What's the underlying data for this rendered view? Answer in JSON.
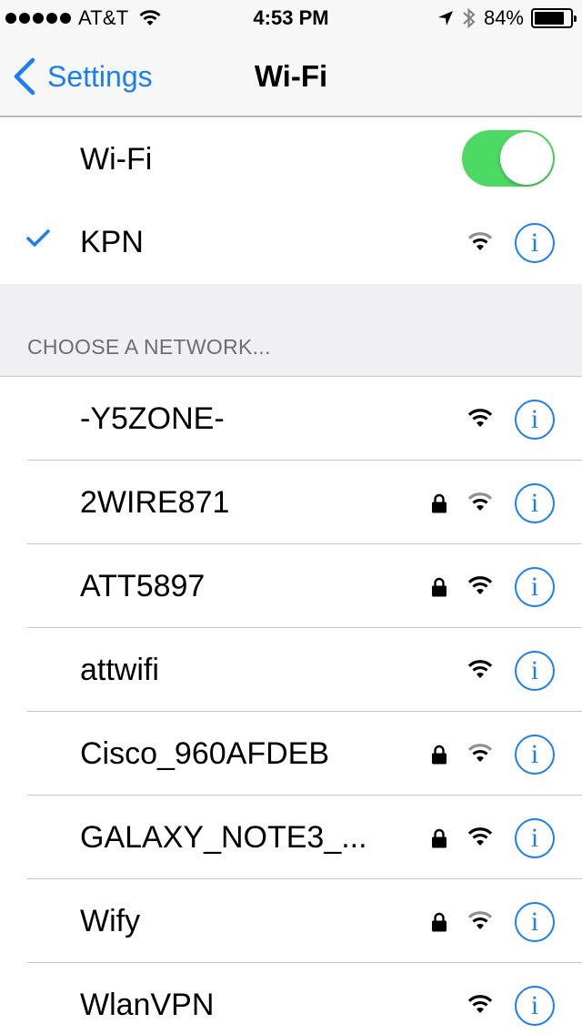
{
  "status_bar": {
    "carrier": "AT&T",
    "time": "4:53 PM",
    "battery_percent_label": "84%",
    "battery_level": 0.84,
    "signal_bars": 5,
    "icons": [
      "wifi-icon",
      "location-arrow-icon",
      "bluetooth-icon",
      "battery-icon"
    ]
  },
  "nav": {
    "back_label": "Settings",
    "title": "Wi-Fi"
  },
  "wifi_toggle": {
    "label": "Wi-Fi",
    "on": true,
    "color": "#4cd964"
  },
  "connected_network": {
    "name": "KPN",
    "checked": true,
    "locked": false,
    "signal": "medium"
  },
  "section_header": "CHOOSE A NETWORK...",
  "networks": [
    {
      "name": "-Y5ZONE-",
      "locked": false,
      "signal": "full"
    },
    {
      "name": "2WIRE871",
      "locked": true,
      "signal": "medium"
    },
    {
      "name": "ATT5897",
      "locked": true,
      "signal": "full"
    },
    {
      "name": "attwifi",
      "locked": false,
      "signal": "full"
    },
    {
      "name": "Cisco_960AFDEB",
      "locked": true,
      "signal": "medium"
    },
    {
      "name": "GALAXY_NOTE3_...",
      "locked": true,
      "signal": "full"
    },
    {
      "name": "Wify",
      "locked": true,
      "signal": "medium"
    },
    {
      "name": "WlanVPN",
      "locked": false,
      "signal": "full"
    }
  ],
  "info_glyph": "i",
  "colors": {
    "accent": "#1a7ef4",
    "toggle_on": "#4cd964",
    "section_bg": "#efeff4",
    "signal_dim": "#8e8e93"
  }
}
